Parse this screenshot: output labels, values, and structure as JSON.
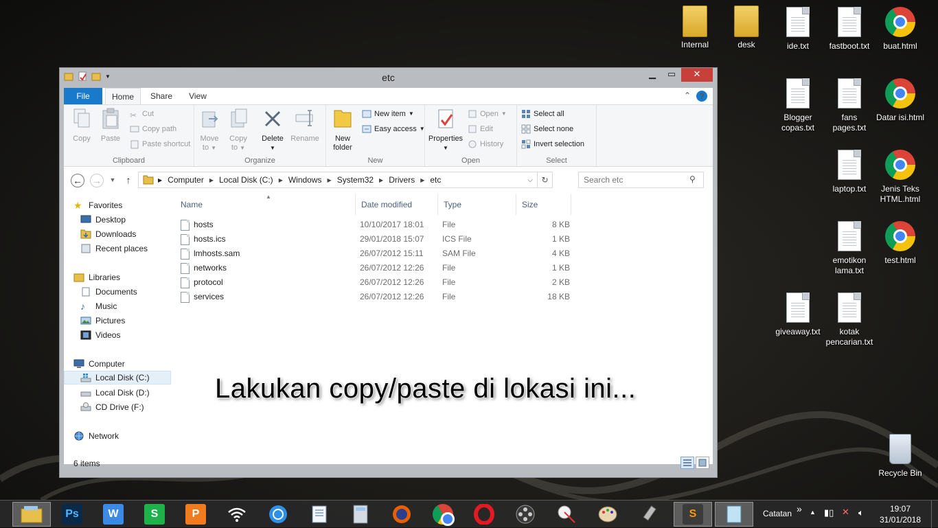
{
  "desktop": {
    "icons": [
      {
        "label": "Internal",
        "kind": "folder"
      },
      {
        "label": "desk",
        "kind": "folder"
      },
      {
        "label": "ide.txt",
        "kind": "doc"
      },
      {
        "label": "fastboot.txt",
        "kind": "doc"
      },
      {
        "label": "buat.html",
        "kind": "chrome"
      },
      {
        "label": "Blogger copas.txt",
        "kind": "doc"
      },
      {
        "label": "fans pages.txt",
        "kind": "doc"
      },
      {
        "label": "Datar isi.html",
        "kind": "chrome"
      },
      {
        "label": "laptop.txt",
        "kind": "doc"
      },
      {
        "label": "Jenis Teks HTML.html",
        "kind": "chrome"
      },
      {
        "label": "emotikon lama.txt",
        "kind": "doc"
      },
      {
        "label": "test.html",
        "kind": "chrome"
      },
      {
        "label": "giveaway.txt",
        "kind": "doc"
      },
      {
        "label": "kotak pencarian.txt",
        "kind": "doc"
      },
      {
        "label": "Recycle Bin",
        "kind": "bin"
      }
    ]
  },
  "window": {
    "title": "etc",
    "close_glyph": "✕",
    "tabs": {
      "file": "File",
      "home": "Home",
      "share": "Share",
      "view": "View"
    },
    "help_glyph": "?",
    "ribbon": {
      "clipboard": {
        "label": "Clipboard",
        "copy": "Copy",
        "paste": "Paste",
        "cut": "Cut",
        "copy_path": "Copy path",
        "paste_shortcut": "Paste shortcut"
      },
      "organize": {
        "label": "Organize",
        "move_to": "Move",
        "move_to_2": "to",
        "copy_to": "Copy",
        "copy_to_2": "to",
        "delete": "Delete",
        "rename": "Rename"
      },
      "new": {
        "label": "New",
        "new_folder": "New",
        "new_folder_2": "folder",
        "new_item": "New item",
        "easy_access": "Easy access"
      },
      "open": {
        "label": "Open",
        "properties": "Properties",
        "open": "Open",
        "edit": "Edit",
        "history": "History"
      },
      "select": {
        "label": "Select",
        "select_all": "Select all",
        "select_none": "Select none",
        "invert_selection": "Invert selection"
      }
    },
    "address": {
      "crumbs": [
        "Computer",
        "Local Disk (C:)",
        "Windows",
        "System32",
        "Drivers",
        "etc"
      ]
    },
    "search_placeholder": "Search etc",
    "nav": {
      "favorites": "Favorites",
      "desktop": "Desktop",
      "downloads": "Downloads",
      "recent": "Recent places",
      "libraries": "Libraries",
      "documents": "Documents",
      "music": "Music",
      "pictures": "Pictures",
      "videos": "Videos",
      "computer": "Computer",
      "local_c": "Local Disk (C:)",
      "local_d": "Local Disk (D:)",
      "cd_drive": "CD Drive (F:)",
      "network": "Network"
    },
    "columns": {
      "name": "Name",
      "date": "Date modified",
      "type": "Type",
      "size": "Size"
    },
    "files": [
      {
        "name": "hosts",
        "date": "10/10/2017 18:01",
        "type": "File",
        "size": "8 KB"
      },
      {
        "name": "hosts.ics",
        "date": "29/01/2018 15:07",
        "type": "ICS File",
        "size": "1 KB"
      },
      {
        "name": "lmhosts.sam",
        "date": "26/07/2012 15:11",
        "type": "SAM File",
        "size": "4 KB"
      },
      {
        "name": "networks",
        "date": "26/07/2012 12:26",
        "type": "File",
        "size": "1 KB"
      },
      {
        "name": "protocol",
        "date": "26/07/2012 12:26",
        "type": "File",
        "size": "2 KB"
      },
      {
        "name": "services",
        "date": "26/07/2012 12:26",
        "type": "File",
        "size": "18 KB"
      }
    ],
    "status": "6 items"
  },
  "caption": "Lakukan copy/paste di lokasi ini...",
  "taskbar": {
    "ps_label": "Ps",
    "wps_w": "W",
    "wps_s": "S",
    "wps_p": "P",
    "catatan": "Catatan",
    "chevron": "»",
    "time": "19:07",
    "date": "31/01/2018"
  },
  "colors": {
    "accent": "#1979ca",
    "close": "#c7403a"
  }
}
